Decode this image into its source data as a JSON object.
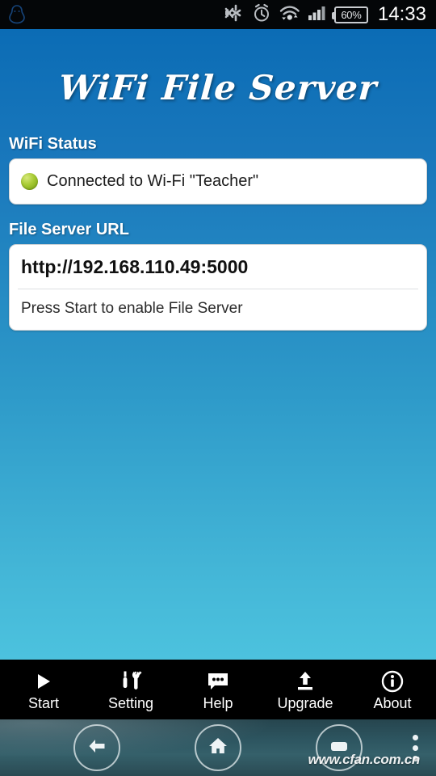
{
  "status_bar": {
    "app_icon": "qq-penguin-icon",
    "icons": [
      "silent-mode-icon",
      "alarm-clock-icon",
      "wifi-data-icon",
      "cellular-signal-icon"
    ],
    "battery_percent": "60%",
    "time": "14:33"
  },
  "app": {
    "title": "WiFi File Server",
    "wifi_status": {
      "label": "WiFi Status",
      "indicator": "green-status-dot",
      "text": "Connected to Wi-Fi \"Teacher\""
    },
    "file_server": {
      "label": "File Server URL",
      "url": "http://192.168.110.49:5000",
      "hint": "Press Start to enable File Server"
    }
  },
  "toolbar": {
    "items": [
      {
        "label": "Start",
        "icon": "play-icon"
      },
      {
        "label": "Setting",
        "icon": "tools-icon"
      },
      {
        "label": "Help",
        "icon": "speech-bubble-icon"
      },
      {
        "label": "Upgrade",
        "icon": "upload-icon"
      },
      {
        "label": "About",
        "icon": "info-circle-icon"
      }
    ]
  },
  "nav_bar": {
    "back": "back-icon",
    "home": "home-icon",
    "recents": "recents-icon",
    "menu": "overflow-menu-icon",
    "watermark": "www.cfan.com.cn"
  },
  "colors": {
    "bg_top": "#0b6cb5",
    "bg_bottom": "#4cc2de",
    "card": "#ffffff",
    "status_dot": "#a9cc36",
    "toolbar": "#000000"
  }
}
